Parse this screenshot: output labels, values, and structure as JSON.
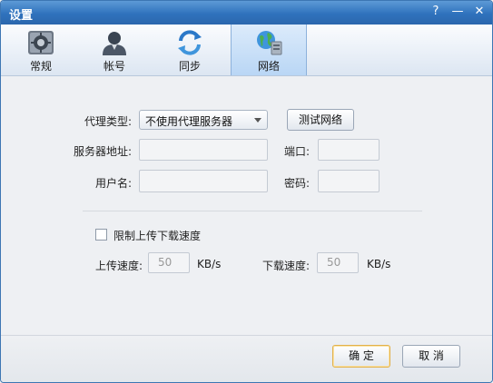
{
  "window": {
    "title": "设置",
    "help_glyph": "?",
    "minimize_glyph": "—",
    "close_glyph": "✕"
  },
  "tabs": [
    {
      "label": "常规",
      "icon": "gear-icon"
    },
    {
      "label": "帐号",
      "icon": "user-icon"
    },
    {
      "label": "同步",
      "icon": "sync-icon"
    },
    {
      "label": "网络",
      "icon": "network-icon",
      "active": true
    }
  ],
  "network": {
    "proxy_type_label": "代理类型:",
    "proxy_type_value": "不使用代理服务器",
    "test_button": "测试网络",
    "server_label": "服务器地址:",
    "server_value": "",
    "port_label": "端口:",
    "port_value": "",
    "username_label": "用户名:",
    "username_value": "",
    "password_label": "密码:",
    "password_value": ""
  },
  "speed": {
    "limit_label": "限制上传下载速度",
    "limit_checked": false,
    "upload_label": "上传速度:",
    "upload_value": "50",
    "upload_unit": "KB/s",
    "download_label": "下载速度:",
    "download_value": "50",
    "download_unit": "KB/s"
  },
  "footer": {
    "ok_button": "确 定",
    "cancel_button": "取 消"
  },
  "colors": {
    "titlebar": "#2f72bd",
    "active_tab": "#c7ddf6",
    "ok_border": "#e2b04a"
  }
}
